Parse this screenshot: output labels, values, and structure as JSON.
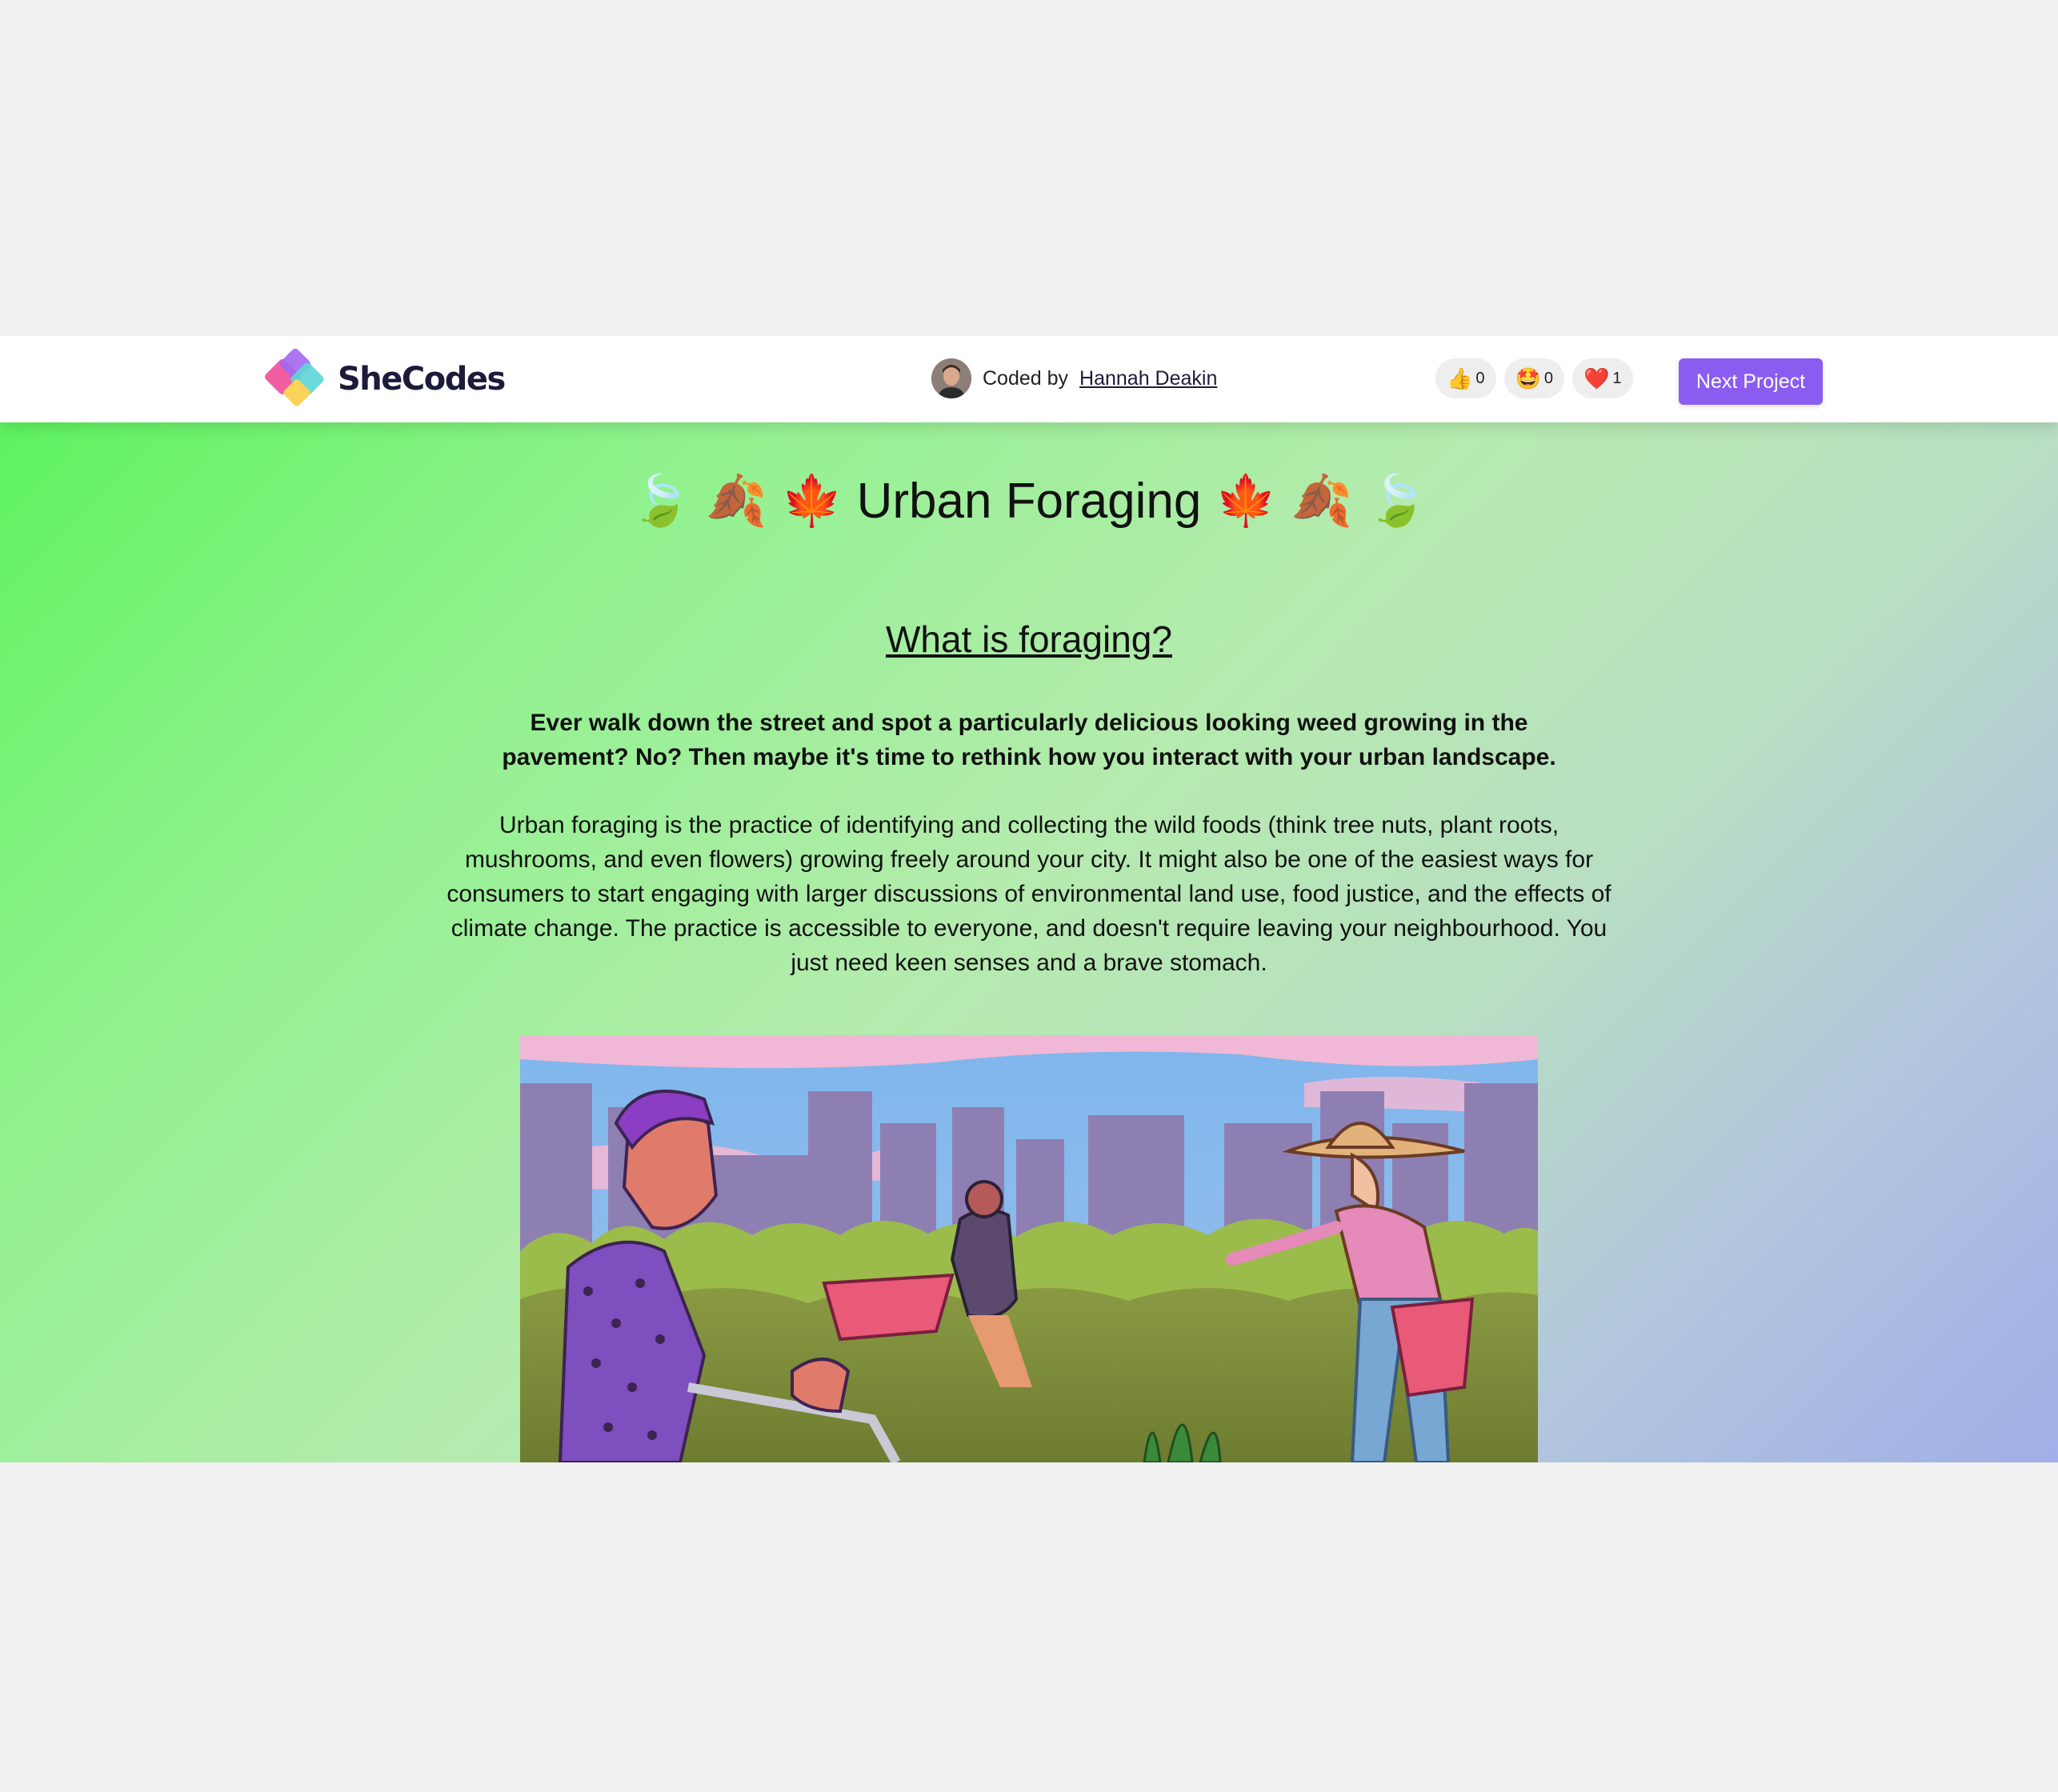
{
  "navbar": {
    "brand": "SheCodes",
    "coded_by_prefix": "Coded by",
    "coder_name": "Hannah Deakin",
    "reactions": [
      {
        "icon": "thumbs-up",
        "emoji": "👍",
        "count": "0"
      },
      {
        "icon": "star-struck",
        "emoji": "🤩",
        "count": "0"
      },
      {
        "icon": "heart",
        "emoji": "❤️",
        "count": "1"
      }
    ],
    "next_label": "Next Project"
  },
  "page": {
    "title": "🍃 🍂 🍁 Urban Foraging 🍁 🍂 🍃",
    "subtitle": "What is foraging?",
    "lead": "Ever walk down the street and spot a particularly delicious looking weed growing in the pavement? No? Then maybe it's time to rethink how you interact with your urban landscape.",
    "body": "Urban foraging is the practice of identifying and collecting the wild foods (think tree nuts, plant roots, mushrooms, and even flowers) growing freely around your city. It might also be one of the easiest ways for consumers to start engaging with larger discussions of environmental land use, food justice, and the effects of climate change. The practice is accessible to everyone, and doesn't require leaving your neighbourhood. You just need keen senses and a brave stomach."
  },
  "colors": {
    "accent": "#8a5cf0",
    "brand_text": "#1d1b3a",
    "gradient_start": "#5ef35f",
    "gradient_end": "#a1aee8"
  }
}
